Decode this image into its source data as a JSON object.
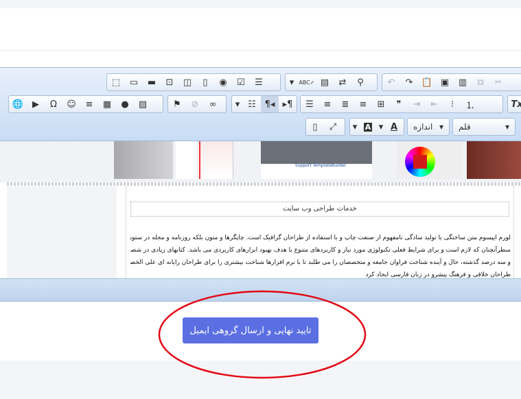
{
  "toolbar": {
    "font_select": "قلم",
    "size_select": "اندازه"
  },
  "editor": {
    "image_caption": "Support TemplateBuilder",
    "title": "خدمات طراحی وب سایت",
    "paragraph_lines": [
      "لورم ایپسوم متن ساختگی با تولید سادگی نامفهوم از صنعت چاپ و با استفاده از طراحان گرافیک است. چاپگرها و متون بلکه روزنامه و مجله در ستون و",
      "سطرآنچنان که لازم است و برای شرایط فعلی تکنولوژی مورد نیاز و کاربردهای متنوع با هدف بهبود ابزارهای کاربردی می باشد. کتابهای زیادی در شصت",
      "و سه درصد گذشته، حال و آینده شناخت فراوان جامعه و متخصصان را می طلبد تا با نرم افزارها شناخت بیشتری را برای طراحان رایانه ای علی الخصوص",
      "طراحان خلاقی و فرهنگ پیشرو در زبان فارسی ایجاد کرد"
    ]
  },
  "footer": {
    "submit_label": "تایید نهایی و ارسال گروهی ایمیل"
  },
  "colors": {
    "submit_bg": "#5b6fe3",
    "annotation": "#e30613"
  }
}
